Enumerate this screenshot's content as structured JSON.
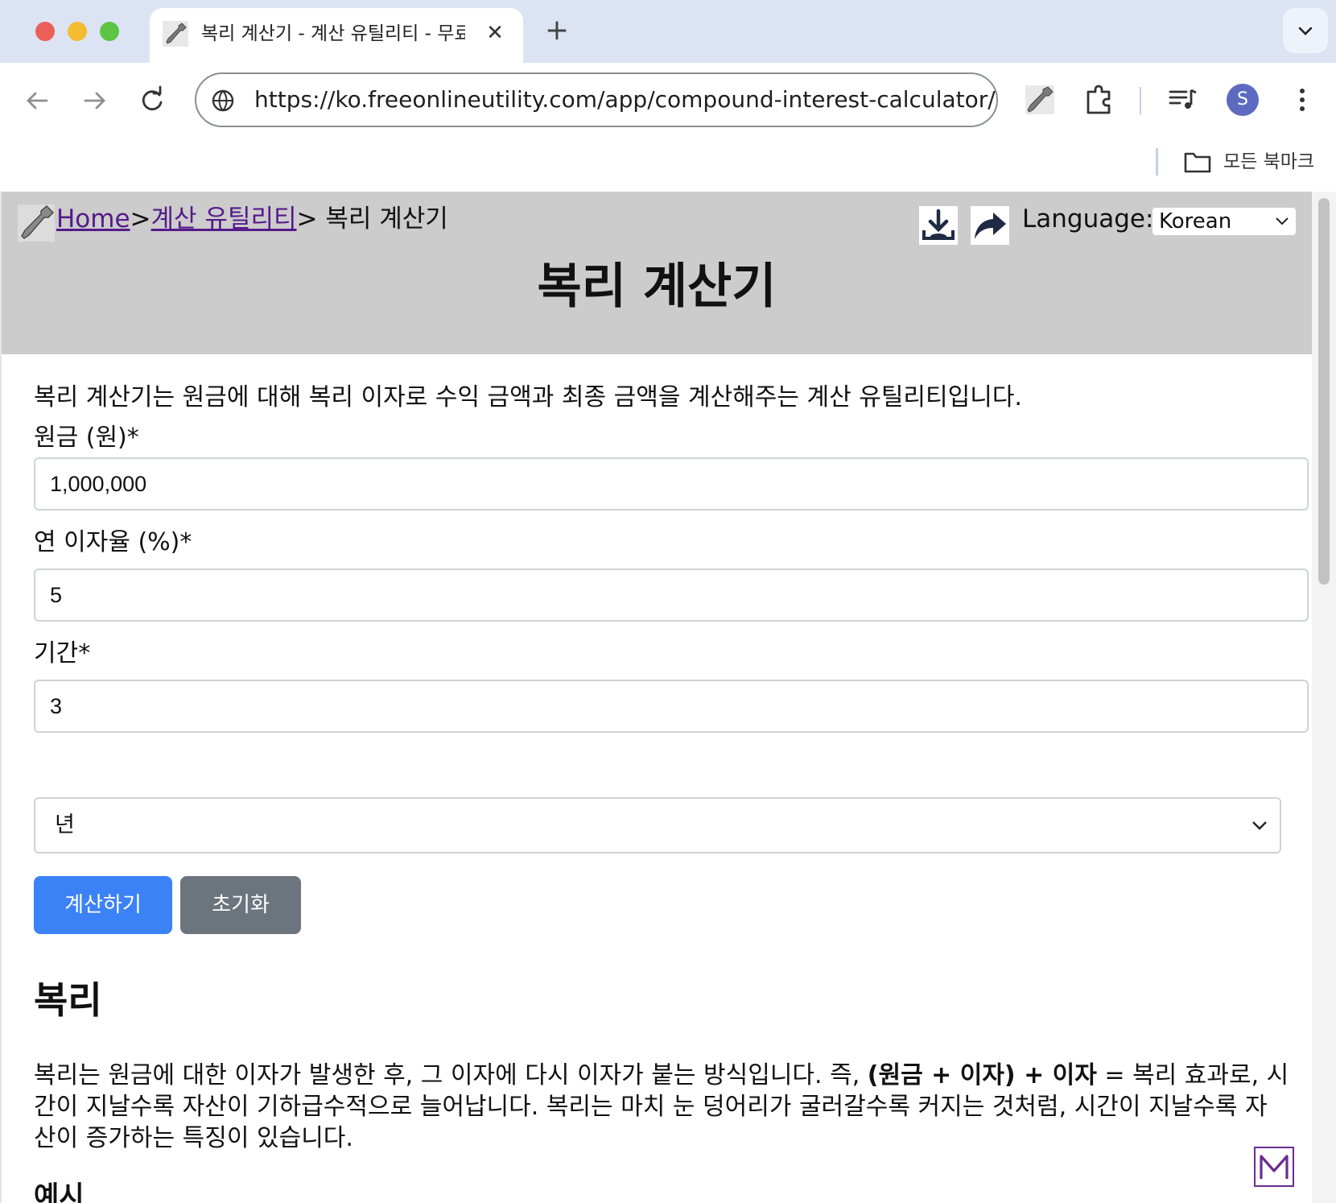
{
  "browser": {
    "tab_title": "복리 계산기 - 계산 유틸리티 - 무료 온라인 유틸리티",
    "tab_close": "✕",
    "new_tab": "+",
    "url": "https://ko.freeonlineutility.com/app/compound-interest-calculator/",
    "avatar_initial": "S",
    "bookmarks_all": "모든 북마크"
  },
  "header": {
    "breadcrumb": {
      "home": "Home",
      "sep": ">",
      "category": "계산 유틸리티",
      "current": "> 복리 계산기"
    },
    "language_label": "Language:",
    "language_value": "Korean",
    "title": "복리 계산기"
  },
  "main": {
    "intro": "복리 계산기는 원금에 대해 복리 이자로 수익 금액과 최종 금액을 계산해주는 계산 유틸리티입니다.",
    "principal_label": "원금 (원)*",
    "principal_value": "1,000,000",
    "rate_label": "연 이자율 (%)*",
    "rate_value": "5",
    "period_label": "기간*",
    "period_value": "3",
    "period_unit": "년",
    "calc_button": "계산하기",
    "reset_button": "초기화",
    "section_title": "복리",
    "para_part1": "복리는 원금에 대한 이자가 발생한 후, 그 이자에 다시 이자가 붙는 방식입니다. 즉, ",
    "para_bold": "(원금 + 이자) + 이자",
    "para_part2": " = 복리 효과로, 시간이 지날수록 자산이 기하급수적으로 늘어납니다. 복리는 마치 눈 덩어리가 굴러갈수록 커지는 것처럼, 시간이 지날수록 자산이 증가하는 특징이 있습니다.",
    "example_title": "예시"
  },
  "colors": {
    "primary_button": "#3b82f6",
    "secondary_button": "#6c757d",
    "header_bg": "#cccccc",
    "link_visited": "#551a8b"
  },
  "icons": [
    "globe-icon",
    "back-icon",
    "forward-icon",
    "reload-icon",
    "puzzle-icon",
    "media-icon",
    "kebab-menu-icon",
    "folder-icon",
    "download-icon",
    "share-icon",
    "chevron-down-icon",
    "wrench-logo-icon"
  ]
}
